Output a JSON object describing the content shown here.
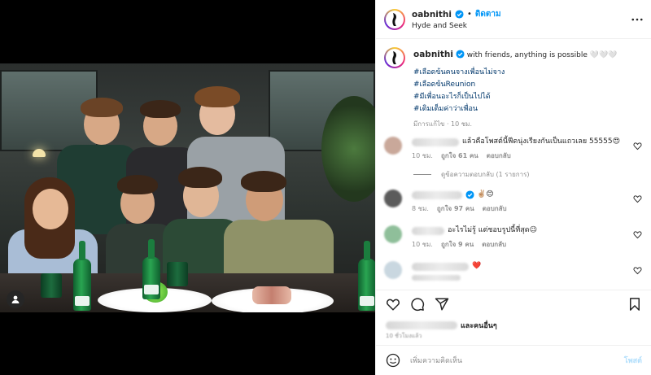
{
  "post": {
    "username": "oabnithi",
    "follow_label": "ติดตาม",
    "dot": "•",
    "audio": "Hyde and Seek",
    "caption_text": "with friends, anything is possible 🤍🤍🤍",
    "hashtags": [
      "#เลือดข้นคนจางเพื่อนไม่จาง",
      "#เลือดข้นReunion",
      "#มีเพื่อนอะไรก็เป็นไปได้",
      "#เติมเต็มค่าว่าเพื่อน"
    ],
    "caption_meta": "มีการแก้ไข · 10 ชม."
  },
  "comments": [
    {
      "text": "แล้วคือโพสต์นี้ฟีดนุ่งเรียงกันเป็นแถวเลย 55555😍",
      "time": "10 ชม.",
      "likes": "ถูกใจ 61 คน",
      "reply": "ตอบกลับ",
      "avatar_color": "#c9a89a"
    },
    {
      "text": "✌🏼😊",
      "time": "8 ชม.",
      "likes": "ถูกใจ 97 คน",
      "reply": "ตอบกลับ",
      "avatar_color": "#5b5b5b"
    },
    {
      "text": "อะไรไม่รู้ แต่ชอบรูปนี้ที่สุด😉",
      "time": "10 ชม.",
      "likes": "ถูกใจ 9 คน",
      "reply": "ตอบกลับ",
      "avatar_color": "#8fbf9a"
    },
    {
      "text": "❤️",
      "time": "",
      "likes": "",
      "reply": "",
      "avatar_color": "#c9d7e0"
    }
  ],
  "view_replies": "ดูข้อความตอบกลับ (1 รายการ)",
  "likes_summary": {
    "suffix": "และคนอื่นๆ",
    "date": "10 ชั่วโมงแล้ว"
  },
  "add_comment": {
    "placeholder": "เพิ่มความคิดเห็น",
    "post_label": "โพสต์"
  },
  "icons": {
    "verified": "verified-badge-icon",
    "more": "more-horizontal-icon",
    "heart": "heart-icon",
    "comment": "comment-icon",
    "share": "send-icon",
    "save": "bookmark-icon",
    "emoji": "emoji-icon",
    "tag": "user-tag-icon"
  },
  "colors": {
    "accent": "#0095f6",
    "verified": "#0095f6",
    "hashtag": "#00376b",
    "muted": "#8e8e8e"
  }
}
